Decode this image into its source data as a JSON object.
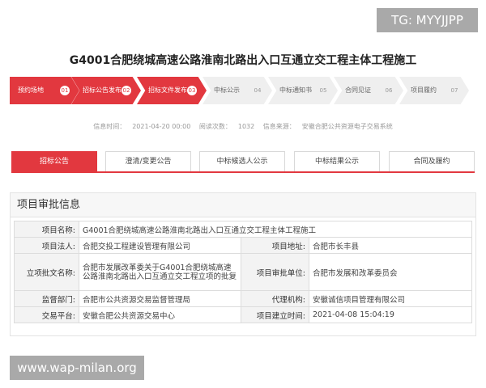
{
  "watermark_top": "TG: MYYJJPP",
  "watermark_bottom": "www.wap-milan.org",
  "page_title": "G4001合肥绕城高速公路淮南北路出入口互通立交工程主体工程施工",
  "steps": [
    {
      "label": "预约场地",
      "num": "01",
      "active": true
    },
    {
      "label": "招标公告发布",
      "num": "02",
      "active": true
    },
    {
      "label": "招标文件发布",
      "num": "03",
      "active": true
    },
    {
      "label": "中标公示",
      "num": "04",
      "active": false
    },
    {
      "label": "中标通知书",
      "num": "05",
      "active": false
    },
    {
      "label": "合同见证",
      "num": "06",
      "active": false
    },
    {
      "label": "项目履约",
      "num": "07",
      "active": false
    }
  ],
  "meta": {
    "time_label": "信息时间：",
    "time_value": "2021-04-20 00:00",
    "views_label": "阅读次数：",
    "views_value": "1032",
    "source_label": "信息来源：",
    "source_value": "安徽合肥公共资源电子交易系统"
  },
  "tabs": [
    {
      "label": "招标公告",
      "active": true
    },
    {
      "label": "澄清/变更公告",
      "active": false
    },
    {
      "label": "中标候选人公示",
      "active": false
    },
    {
      "label": "中标结果公示",
      "active": false
    },
    {
      "label": "合同及履约",
      "active": false
    }
  ],
  "panel": {
    "title": "项目审批信息",
    "rows": {
      "name_label": "项目名称:",
      "name_value": "G4001合肥绕城高速公路淮南北路出入口互通立交工程主体工程施工",
      "legal_label": "项目法人:",
      "legal_value": "合肥交投工程建设管理有限公司",
      "addr_label": "项目地址:",
      "addr_value": "合肥市长丰县",
      "doc_label": "立项批文名称:",
      "doc_value": "合肥市发展改革委关于G4001合肥绕城高速公路淮南北路出入口互通立交工程立项的批复",
      "unit_label": "项目审批单位:",
      "unit_value": "合肥市发展和改革委员会",
      "sup_label": "监督部门:",
      "sup_value": "合肥市公共资源交易监督管理局",
      "agent_label": "代理机构:",
      "agent_value": "安徽诚信项目管理有限公司",
      "plat_label": "交易平台:",
      "plat_value": "安徽合肥公共资源交易中心",
      "est_label": "项目建立时间:",
      "est_value": "2021-04-08 15:04:19"
    }
  },
  "colors": {
    "accent": "#e2383f"
  }
}
